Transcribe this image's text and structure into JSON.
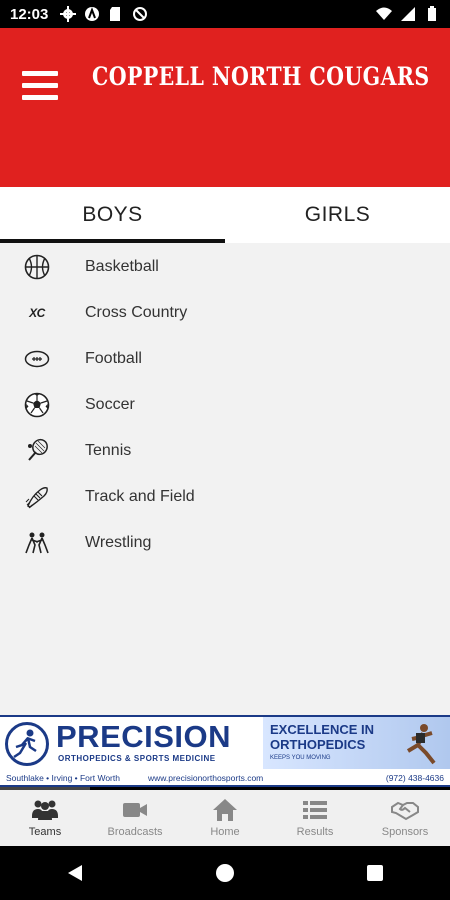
{
  "status": {
    "time": "12:03"
  },
  "app": {
    "title": "COPPELL NORTH COUGARS"
  },
  "tabs": [
    {
      "label": "BOYS",
      "active": true
    },
    {
      "label": "GIRLS",
      "active": false
    }
  ],
  "sports": [
    {
      "label": "Basketball",
      "icon": "basketball-icon"
    },
    {
      "label": "Cross Country",
      "icon": "cross-country-icon",
      "icon_text": "XC"
    },
    {
      "label": "Football",
      "icon": "football-icon"
    },
    {
      "label": "Soccer",
      "icon": "soccer-ball-icon"
    },
    {
      "label": "Tennis",
      "icon": "tennis-racket-icon"
    },
    {
      "label": "Track and Field",
      "icon": "track-shoe-icon"
    },
    {
      "label": "Wrestling",
      "icon": "wrestling-icon"
    }
  ],
  "banner": {
    "brand": "PRECISION",
    "subbrand": "ORTHOPEDICS & SPORTS MEDICINE",
    "tagline": "EXCELLENCE IN ORTHOPEDICS",
    "keeps": "KEEPS YOU MOVING",
    "locations": "Southlake • Irving • Fort Worth",
    "website": "www.precisionorthosports.com",
    "phone": "(972) 438-4636"
  },
  "bottom_nav": [
    {
      "label": "Teams",
      "icon": "teams-icon",
      "active": true
    },
    {
      "label": "Broadcasts",
      "icon": "video-camera-icon",
      "active": false
    },
    {
      "label": "Home",
      "icon": "home-icon",
      "active": false
    },
    {
      "label": "Results",
      "icon": "list-icon",
      "active": false
    },
    {
      "label": "Sponsors",
      "icon": "handshake-icon",
      "active": false
    }
  ],
  "colors": {
    "brand_red": "#e0211f",
    "banner_blue": "#1b3a87"
  }
}
